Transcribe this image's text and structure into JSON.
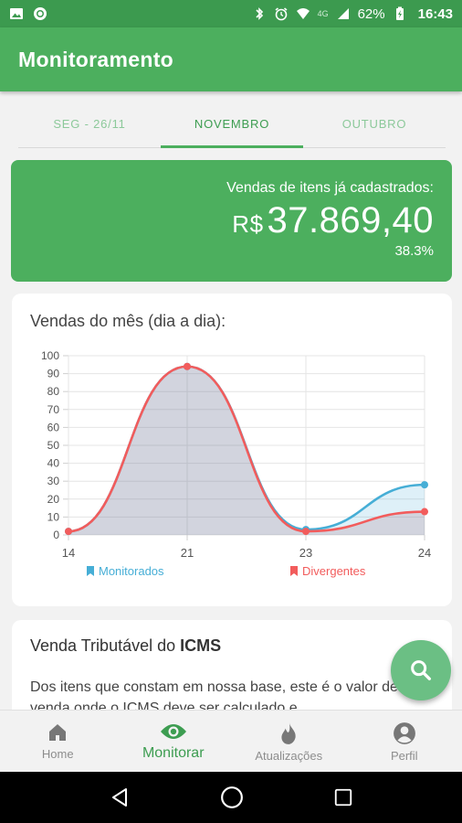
{
  "status_bar": {
    "network": "4G",
    "battery": "62%",
    "time": "16:43"
  },
  "app_bar": {
    "title": "Monitoramento"
  },
  "tabs": [
    {
      "label": "SEG - 26/11",
      "active": false
    },
    {
      "label": "NOVEMBRO",
      "active": true
    },
    {
      "label": "OUTUBRO",
      "active": false
    }
  ],
  "sales_card": {
    "label": "Vendas de itens já cadastrados:",
    "currency": "R$",
    "value": "37.869,40",
    "percent": "38.3%",
    "color": "#4caf5e"
  },
  "chart_card": {
    "title": "Vendas do mês (dia a dia):"
  },
  "chart_data": {
    "type": "area",
    "x": [
      "14",
      "21",
      "23",
      "24"
    ],
    "series": [
      {
        "name": "Monitorados",
        "values": [
          2,
          94,
          3,
          28
        ],
        "color": "#46aed6"
      },
      {
        "name": "Divergentes",
        "values": [
          2,
          94,
          2,
          13
        ],
        "color": "#f25c5c"
      }
    ],
    "ylim": [
      0,
      100
    ],
    "yticks": [
      "0",
      "10",
      "20",
      "30",
      "40",
      "50",
      "60",
      "70",
      "80",
      "90",
      "100"
    ],
    "grid": true,
    "legend": "bottom"
  },
  "icms_card": {
    "title_prefix": "Venda Tributável do ",
    "title_bold": "ICMS",
    "text": "Dos itens que constam em nossa base, este é o valor de sua venda onde o ICMS deve ser calculado e"
  },
  "fab": {
    "icon": "search-icon"
  },
  "bottom_nav": [
    {
      "label": "Home",
      "icon": "home-icon",
      "active": false
    },
    {
      "label": "Monitorar",
      "icon": "eye-icon",
      "active": true
    },
    {
      "label": "Atualizações",
      "icon": "flame-icon",
      "active": false
    },
    {
      "label": "Perfil",
      "icon": "account-icon",
      "active": false
    }
  ]
}
